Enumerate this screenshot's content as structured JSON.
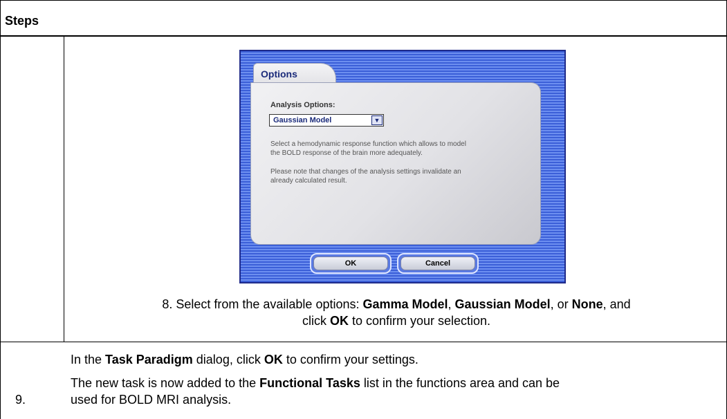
{
  "table": {
    "header": "Steps"
  },
  "dialog": {
    "tab_label": "Options",
    "analysis_label": "Analysis Options:",
    "selected_option": "Gaussian Model",
    "dropdown_glyph": "▼",
    "description_1_line1": "Select a hemodynamic response function which allows to model",
    "description_1_line2": "the BOLD response of the brain more adequately.",
    "description_2_line1": "Please note that changes of the analysis settings invalidate an",
    "description_2_line2": "already calculated result.",
    "ok_label": "OK",
    "cancel_label": "Cancel"
  },
  "step8": {
    "prefix": "8. Select from the available options: ",
    "opt1": "Gamma Model",
    "sep1": ", ",
    "opt2": "Gaussian Model",
    "sep2": ", or ",
    "opt3": "None",
    "after": ", and",
    "line2_pre": "click ",
    "line2_ok": "OK",
    "line2_post": " to confirm your selection."
  },
  "step9": {
    "number": "9.",
    "l1_pre": "In the ",
    "l1_dialog": "Task Paradigm",
    "l1_mid": " dialog, click ",
    "l1_ok": "OK",
    "l1_post": " to confirm your settings.",
    "l2_pre": "The new task is now added to the ",
    "l2_list": "Functional Tasks",
    "l2_post": " list in the functions area and can be",
    "l3": "used for BOLD MRI analysis."
  }
}
